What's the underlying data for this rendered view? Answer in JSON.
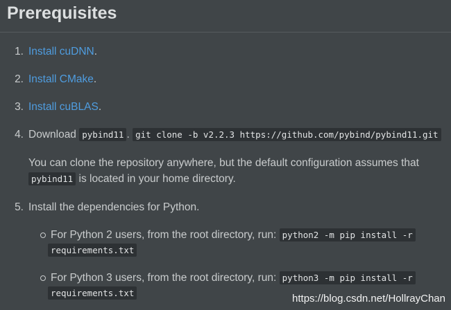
{
  "heading": "Prerequisites",
  "steps": [
    {
      "number": "1.",
      "link": "Install cuDNN",
      "suffix": "."
    },
    {
      "number": "2.",
      "link": "Install CMake",
      "suffix": "."
    },
    {
      "number": "3.",
      "link": "Install cuBLAS",
      "suffix": "."
    },
    {
      "number": "4.",
      "text": "Download",
      "code1": "pybind11",
      "sep": ".",
      "code2": "git clone -b v2.2.3 https://github.com/pybind/pybind11.git",
      "note_text": "You can clone the repository anywhere, but the default configuration assumes that",
      "note_code": "pybind11",
      "note_suffix": "is located in your home directory."
    },
    {
      "number": "5.",
      "text": "Install the dependencies for Python.",
      "subitems": [
        {
          "text": "For Python 2 users, from the root directory, run:",
          "code_a": "python2 -m pip install -r",
          "code_b": "requirements.txt"
        },
        {
          "text": "For Python 3 users, from the root directory, run:",
          "code_a": "python3 -m pip install -r",
          "code_b": "requirements.txt"
        }
      ]
    }
  ],
  "watermark": "https://blog.csdn.net/HollrayChan"
}
